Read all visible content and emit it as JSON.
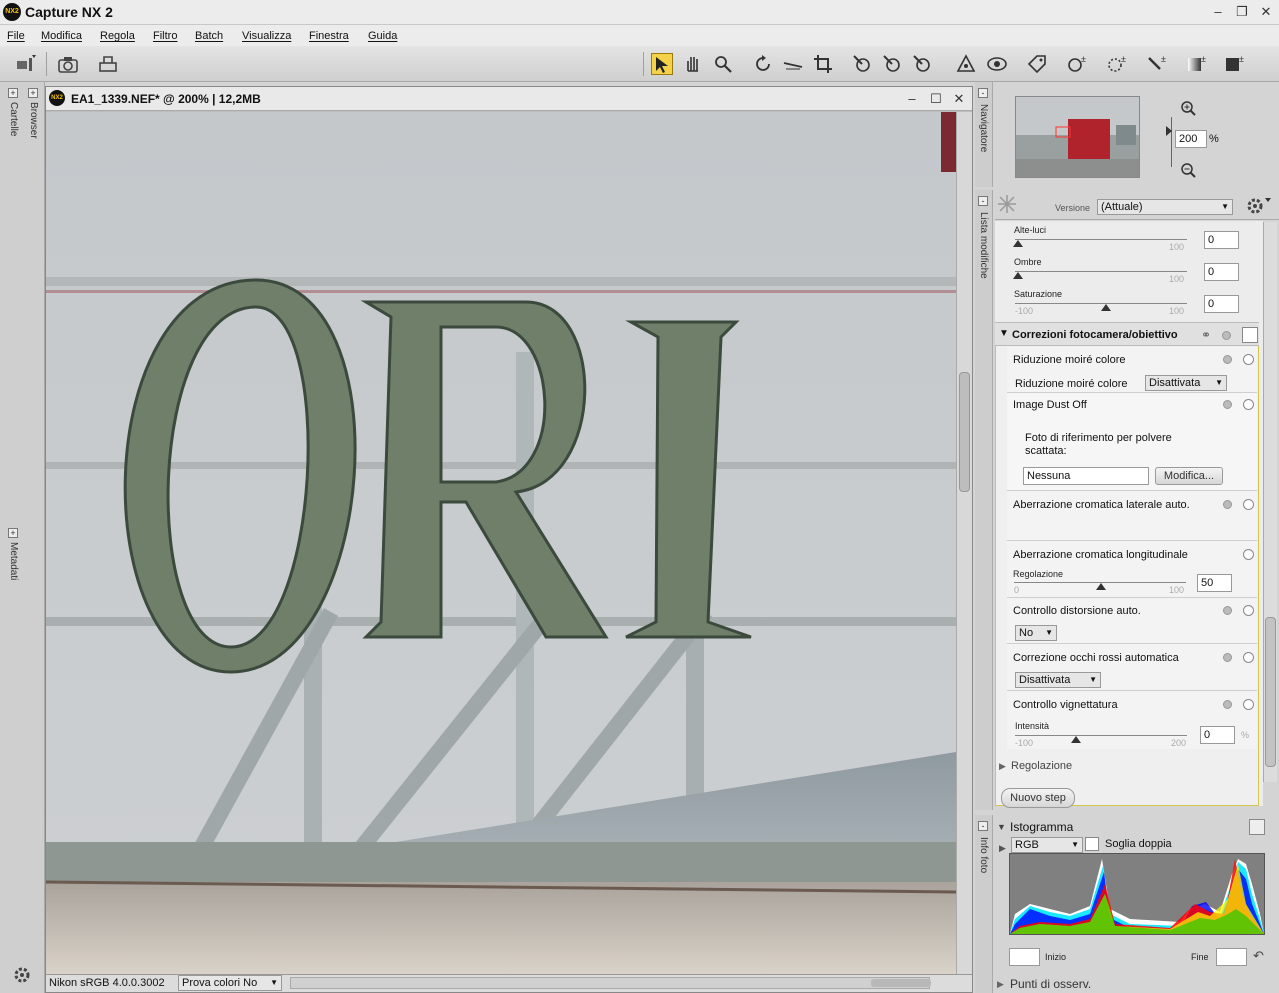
{
  "app": {
    "title": "Capture NX 2",
    "logo": "NX2"
  },
  "menu": [
    "File",
    "Modifica",
    "Regola",
    "Filtro",
    "Batch",
    "Visualizza",
    "Finestra",
    "Guida"
  ],
  "left_tabs": {
    "folders": "Cartelle",
    "browser": "Browser",
    "metadata": "Metadati"
  },
  "document": {
    "title": "EA1_1339.NEF* @ 200% | 12,2MB",
    "profile": "Nikon sRGB 4.0.0.3002",
    "proof": "Prova colori No",
    "image_text": "ORI"
  },
  "navigator": {
    "tab": "Navigatore",
    "zoom": "200",
    "zoom_unit": "%"
  },
  "edit_list": {
    "tab": "Lista modifiche",
    "version_label": "Versione",
    "version_value": "(Attuale)",
    "sliders": [
      {
        "label": "Alte-luci",
        "min": "",
        "max": "100",
        "value": "0"
      },
      {
        "label": "Ombre",
        "min": "",
        "max": "100",
        "value": "0"
      },
      {
        "label": "Saturazione",
        "min": "-100",
        "max": "100",
        "value": "0"
      }
    ],
    "section_title": "Correzioni fotocamera/obiettivo",
    "moire": {
      "title": "Riduzione moiré colore",
      "sub_label": "Riduzione moiré colore",
      "sub_value": "Disattivata"
    },
    "dust": {
      "title": "Image Dust Off",
      "desc": "Foto di riferimento per polvere scattata:",
      "value": "Nessuna",
      "button": "Modifica..."
    },
    "lat_ca": {
      "title": "Aberrazione cromatica laterale auto."
    },
    "long_ca": {
      "title": "Aberrazione cromatica longitudinale",
      "label": "Regolazione",
      "min": "0",
      "max": "100",
      "value": "50"
    },
    "distortion": {
      "title": "Controllo distorsione auto.",
      "value": "No"
    },
    "redeye": {
      "title": "Correzione occhi rossi automatica",
      "value": "Disattivata"
    },
    "vignette": {
      "title": "Controllo vignettatura",
      "label": "Intensità",
      "min": "-100",
      "max": "200",
      "value": "0",
      "unit": "%"
    },
    "collapsed": "Regolazione",
    "new_step": "Nuovo step"
  },
  "info": {
    "tab": "Info foto",
    "histogram_title": "Istogramma",
    "channel": "RGB",
    "double_threshold": "Soglia doppia",
    "start_label": "Inizio",
    "end_label": "Fine",
    "points": "Punti di osserv."
  }
}
